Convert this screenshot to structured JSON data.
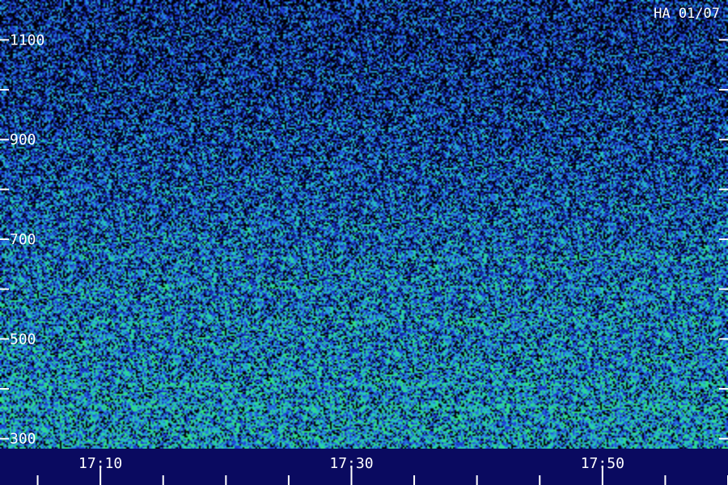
{
  "chart_data": {
    "type": "heatmap",
    "title": "",
    "xlabel": "",
    "ylabel": "",
    "corner_label": "HA 01/07",
    "x_ticks": [
      "17:10",
      "17:30",
      "17:50"
    ],
    "x_range": [
      "17:02",
      "18:00"
    ],
    "x_major_every_minutes": 20,
    "x_minor_every_minutes": 5,
    "y_ticks": [
      1100,
      900,
      700,
      500,
      300
    ],
    "y_range": [
      280,
      1180
    ],
    "y_minor_every": 100,
    "colormap": [
      "#000000",
      "#0a1470",
      "#1e3cdc",
      "#2a7de0",
      "#22c8c8",
      "#30e080"
    ],
    "intensity_profile": {
      "freq": [
        1150,
        1000,
        900,
        800,
        700,
        600,
        500,
        400,
        320
      ],
      "level": [
        0.32,
        0.36,
        0.42,
        0.48,
        0.55,
        0.6,
        0.64,
        0.68,
        0.72
      ]
    },
    "bright_bands": [
      {
        "freq": 665,
        "strength": 0.3
      },
      {
        "freq": 605,
        "strength": 0.25
      },
      {
        "freq": 535,
        "strength": 0.3
      },
      {
        "freq": 410,
        "strength": 0.35
      },
      {
        "freq": 365,
        "strength": 0.4
      }
    ],
    "grid": false,
    "legend": "none"
  }
}
